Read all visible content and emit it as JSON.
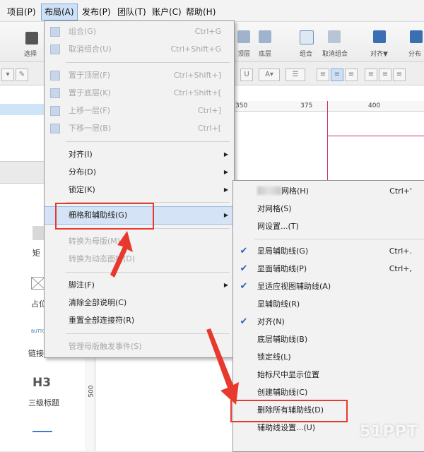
{
  "menubar": {
    "items": [
      {
        "label": "项目(P)"
      },
      {
        "label": "布局(A)"
      },
      {
        "label": "发布(P)"
      },
      {
        "label": "团队(T)"
      },
      {
        "label": "账户(C)"
      },
      {
        "label": "帮助(H)"
      }
    ]
  },
  "toolbar": {
    "labels": [
      "选择",
      "顶层",
      "底层",
      "组合",
      "取消组合",
      "对齐▼",
      "分布"
    ]
  },
  "ruler": {
    "top": [
      "350",
      "375",
      "400"
    ],
    "left": [
      "500"
    ]
  },
  "left_panel": {
    "items": [
      "矩",
      "占位",
      "BUTTON",
      "链接",
      "H3",
      "三级标题"
    ]
  },
  "layout_menu": {
    "items": [
      {
        "label": "组合(G)",
        "shortcut": "Ctrl+G",
        "disabled": true
      },
      {
        "label": "取消组合(U)",
        "shortcut": "Ctrl+Shift+G",
        "disabled": true
      },
      {
        "label": "置于顶层(F)",
        "shortcut": "Ctrl+Shift+]",
        "disabled": true
      },
      {
        "label": "置于底层(K)",
        "shortcut": "Ctrl+Shift+[",
        "disabled": true
      },
      {
        "label": "上移一层(F)",
        "shortcut": "Ctrl+]",
        "disabled": true
      },
      {
        "label": "下移一层(B)",
        "shortcut": "Ctrl+[",
        "disabled": true
      },
      {
        "label": "对齐(I)",
        "shortcut": "",
        "disabled": false
      },
      {
        "label": "分布(D)",
        "shortcut": "",
        "disabled": false
      },
      {
        "label": "锁定(K)",
        "shortcut": "",
        "disabled": false
      },
      {
        "label": "栅格和辅助线(G)",
        "shortcut": "",
        "disabled": false
      },
      {
        "label": "转换为母版(M)",
        "shortcut": "",
        "disabled": true
      },
      {
        "label": "转换为动态面板(D)",
        "shortcut": "",
        "disabled": true
      },
      {
        "label": "脚注(F)",
        "shortcut": "",
        "disabled": false
      },
      {
        "label": "清除全部说明(C)",
        "shortcut": "",
        "disabled": false
      },
      {
        "label": "重置全部连接符(R)",
        "shortcut": "",
        "disabled": false
      },
      {
        "label": "管理母版触发事件(S)",
        "shortcut": "",
        "disabled": true
      }
    ]
  },
  "grid_submenu": {
    "items": [
      {
        "label": "网格(H)",
        "shortcut": "Ctrl+'",
        "checked": false
      },
      {
        "label": "对网格(S)",
        "shortcut": "",
        "checked": false
      },
      {
        "label": "网设置...(T)",
        "shortcut": "",
        "checked": false
      },
      {
        "label": "显局辅助线(G)",
        "shortcut": "Ctrl+.",
        "checked": true
      },
      {
        "label": "显面辅助线(P)",
        "shortcut": "Ctrl+,",
        "checked": true
      },
      {
        "label": "显适应视图辅助线(A)",
        "shortcut": "",
        "checked": true
      },
      {
        "label": "显辅助线(R)",
        "shortcut": "",
        "checked": false
      },
      {
        "label": "对齐(N)",
        "shortcut": "",
        "checked": true
      },
      {
        "label": "底层辅助线(B)",
        "shortcut": "",
        "checked": false
      },
      {
        "label": "锁定线(L)",
        "shortcut": "",
        "checked": false
      },
      {
        "label": "始标尺中显示位置",
        "shortcut": "",
        "checked": false
      },
      {
        "label": "创建辅助线(C)",
        "shortcut": "",
        "checked": false
      },
      {
        "label": "删除所有辅助线(D)",
        "shortcut": "",
        "checked": false
      },
      {
        "label": "辅助线设置...(U)",
        "shortcut": "",
        "checked": false
      }
    ]
  },
  "watermark": "51PPT",
  "colors": {
    "highlight": "#e8392f",
    "guide": "#c8326a",
    "check": "#2b64b8"
  }
}
